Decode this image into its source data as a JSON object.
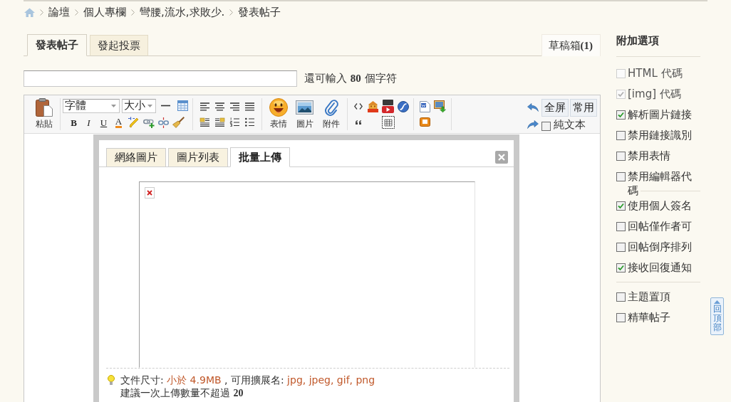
{
  "breadcrumb": [
    "論壇",
    "個人專欄",
    "彎腰,流水,求敗少.",
    "發表帖子"
  ],
  "post_tabs": [
    {
      "label": "發表帖子",
      "selected": true
    },
    {
      "label": "發起投票",
      "selected": false
    }
  ],
  "drafts_button": "草稿箱**(1)**",
  "title_field": {
    "remaining_note": "還可輸入 **80** 個字符"
  },
  "editor_toolbar": {
    "paste_label": "粘貼",
    "font_select": "字體",
    "size_select": "大小",
    "format_buttons": [
      "B",
      "I",
      "U",
      "A"
    ],
    "insert_buttons": [
      "表情",
      "圖片",
      "附件"
    ],
    "mode_buttons": [
      "全屏",
      "常用"
    ],
    "plain_text": {
      "label": "純文本",
      "checked": false
    }
  },
  "image_dialog": {
    "tabs": [
      {
        "label": "網絡圖片",
        "selected": false
      },
      {
        "label": "圖片列表",
        "selected": false
      },
      {
        "label": "批量上傳",
        "selected": true
      }
    ],
    "file_info": [
      {
        "text": "文件尺寸: ",
        "highlight": false
      },
      {
        "text": "小於 4.9MB",
        "highlight": true
      },
      {
        "text": " , 可用擴展名: ",
        "highlight": false
      },
      {
        "text": "jpg, jpeg, gif, png",
        "highlight": true
      }
    ],
    "upload_limit": "建議一次上傳數量不超過 **20**"
  },
  "options": {
    "title": "附加選項",
    "groups": [
      {
        "items": [
          {
            "label": "HTML 代碼",
            "checked": false,
            "disabled": true
          },
          {
            "label": "[img] 代碼",
            "checked": true,
            "disabled": true
          },
          {
            "label": "解析圖片鏈接",
            "checked": true,
            "disabled": false
          },
          {
            "label": "禁用鏈接識別",
            "checked": false,
            "disabled": false
          },
          {
            "label": "禁用表情",
            "checked": false,
            "disabled": false
          },
          {
            "label": "禁用編輯器代碼",
            "checked": false,
            "disabled": false
          }
        ]
      },
      {
        "items": [
          {
            "label": "使用個人簽名",
            "checked": true,
            "disabled": false
          },
          {
            "label": "回帖僅作者可",
            "checked": false,
            "disabled": false
          },
          {
            "label": "回帖倒序排列",
            "checked": false,
            "disabled": false
          },
          {
            "label": "接收回復通知",
            "checked": true,
            "disabled": false
          }
        ]
      },
      {
        "items": [
          {
            "label": "主題置頂",
            "checked": false,
            "disabled": false
          },
          {
            "label": "精華帖子",
            "checked": false,
            "disabled": false
          }
        ]
      }
    ]
  },
  "back_to_top": "回頂部"
}
